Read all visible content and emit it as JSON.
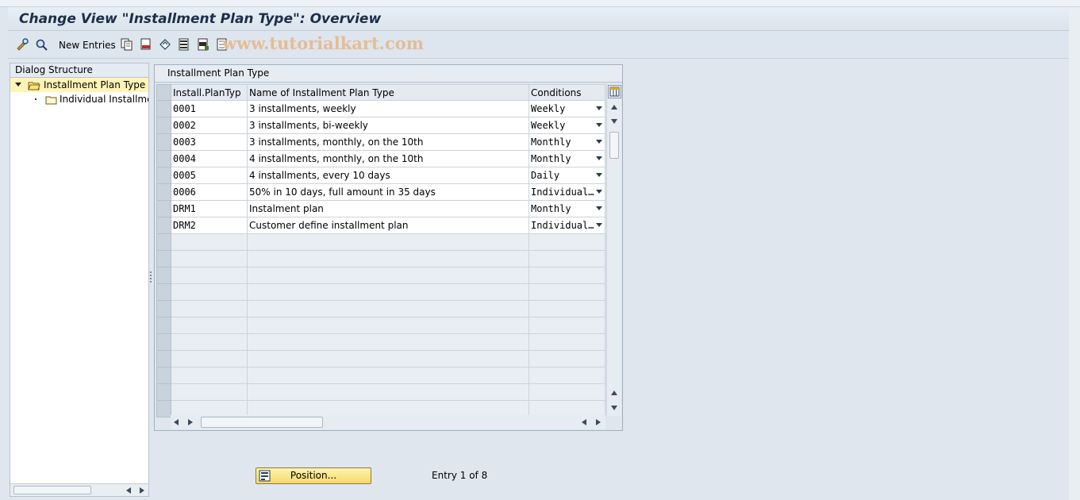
{
  "title": "Change View \"Installment Plan Type\": Overview",
  "toolbar": {
    "new_entries_label": "New Entries",
    "icons": [
      "display-change-icon",
      "find-icon",
      "copy-icon",
      "delete-icon",
      "undo-icon",
      "select-all-icon",
      "select-block-icon",
      "deselect-all-icon"
    ]
  },
  "watermark": "www.tutorialkart.com",
  "dialog_structure": {
    "header": "Dialog Structure",
    "items": [
      {
        "label": "Installment Plan Type",
        "selected": true,
        "level": 0
      },
      {
        "label": "Individual Installment",
        "selected": false,
        "level": 1
      }
    ]
  },
  "table": {
    "title": "Installment Plan Type",
    "columns": [
      "Install.PlanTyp",
      "Name of Installment Plan Type",
      "Conditions"
    ],
    "rows": [
      {
        "code": "0001",
        "name": "3 installments, weekly",
        "condition": "Weekly"
      },
      {
        "code": "0002",
        "name": "3 installments, bi-weekly",
        "condition": "Weekly"
      },
      {
        "code": "0003",
        "name": "3 installments, monthly, on the 10th",
        "condition": "Monthly"
      },
      {
        "code": "0004",
        "name": "4 installments, monthly, on the 10th",
        "condition": "Monthly"
      },
      {
        "code": "0005",
        "name": "4 installments, every 10 days",
        "condition": "Daily"
      },
      {
        "code": "0006",
        "name": "50% in 10 days, full amount in 35 days",
        "condition": "Individual…"
      },
      {
        "code": "DRM1",
        "name": "Instalment plan",
        "condition": "Monthly"
      },
      {
        "code": "DRM2",
        "name": "Customer define installment plan",
        "condition": "Individual…"
      }
    ],
    "empty_rows": 11
  },
  "position_button_label": "Position...",
  "entry_info": "Entry 1 of 8",
  "colors": {
    "background": "#dfe6ee",
    "title_text": "#1c2e48",
    "selected_tree": "#fff5b8",
    "button": "#f5d96a"
  }
}
